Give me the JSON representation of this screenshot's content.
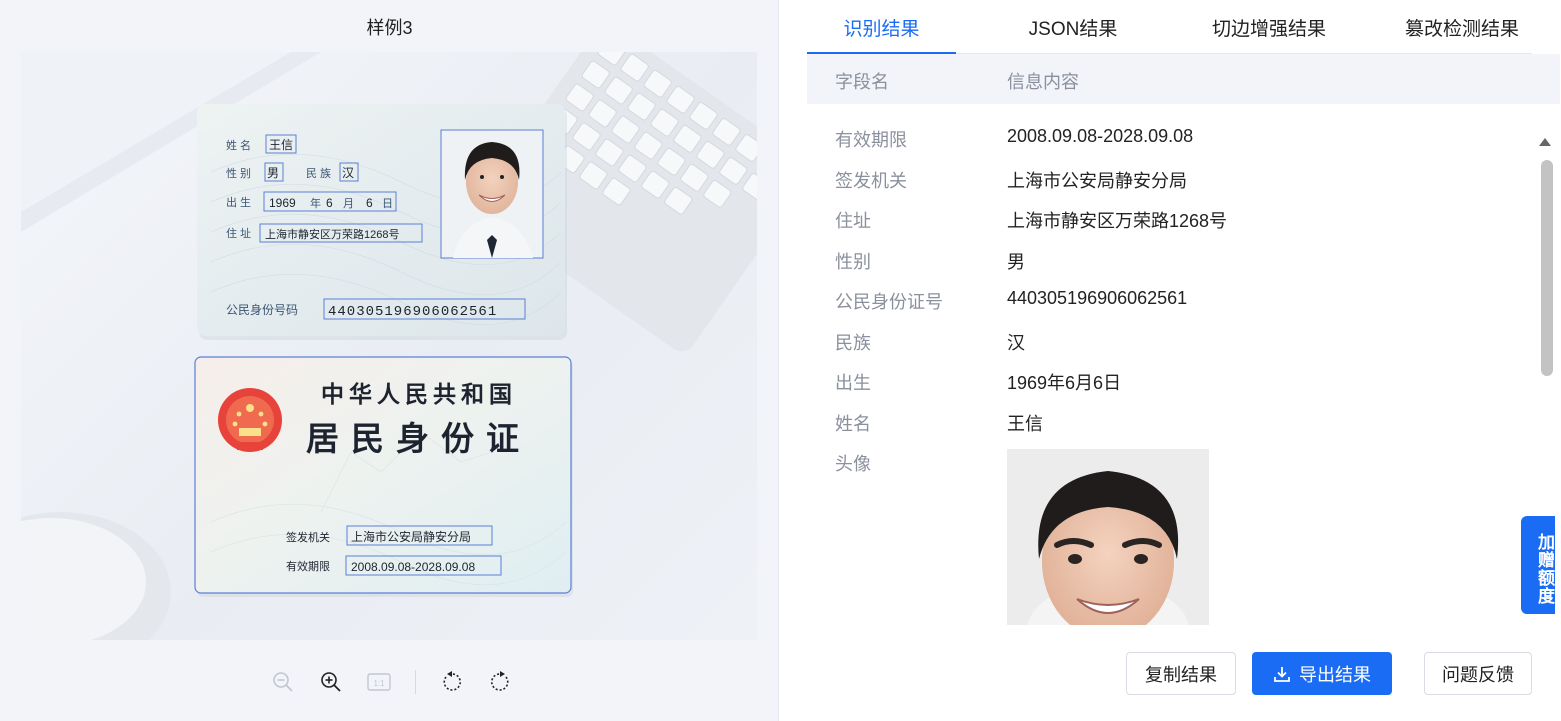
{
  "sample": {
    "title": "样例3",
    "front_card": {
      "name_label": "姓 名",
      "name": "王信",
      "gender_label": "性 别",
      "gender": "男",
      "ethnicity_label": "民 族",
      "ethnicity": "汉",
      "birth_label": "出 生",
      "birth_year": "1969",
      "year_unit": "年",
      "birth_month": "6",
      "month_unit": "月",
      "birth_day": "6",
      "day_unit": "日",
      "address_label": "住 址",
      "address": "上海市静安区万荣路1268号",
      "id_label": "公民身份号码",
      "id_number": "440305196906062561"
    },
    "back_card": {
      "country": "中华人民共和国",
      "card_title": "居民身份证",
      "authority_label": "签发机关",
      "authority": "上海市公安局静安分局",
      "validity_label": "有效期限",
      "validity": "2008.09.08-2028.09.08"
    },
    "toolbar_icons": [
      "zoom-out-icon",
      "zoom-in-icon",
      "actual-size-icon",
      "rotate-left-icon",
      "rotate-right-icon"
    ],
    "actual_size_label": "1:1"
  },
  "tabs": [
    {
      "label": "识别结果",
      "active": true
    },
    {
      "label": "JSON结果",
      "active": false
    },
    {
      "label": "切边增强结果",
      "active": false
    },
    {
      "label": "篡改检测结果",
      "active": false
    }
  ],
  "table": {
    "header_field": "字段名",
    "header_value": "信息内容",
    "rows": [
      {
        "key": "有效期限",
        "value": "2008.09.08-2028.09.08"
      },
      {
        "key": "签发机关",
        "value": "上海市公安局静安分局"
      },
      {
        "key": "住址",
        "value": "上海市静安区万荣路1268号"
      },
      {
        "key": "性别",
        "value": "男"
      },
      {
        "key": "公民身份证号",
        "value": "440305196906062561"
      },
      {
        "key": "民族",
        "value": "汉"
      },
      {
        "key": "出生",
        "value": "1969年6月6日"
      },
      {
        "key": "姓名",
        "value": "王信"
      },
      {
        "key": "头像",
        "value": ""
      }
    ]
  },
  "side_tag": "加赠额度",
  "buttons": {
    "copy": "复制结果",
    "export": "导出结果",
    "feedback": "问题反馈"
  },
  "colors": {
    "accent": "#1a6cf5",
    "panel_bg": "#f2f4f9",
    "muted_text": "#8a909c"
  }
}
